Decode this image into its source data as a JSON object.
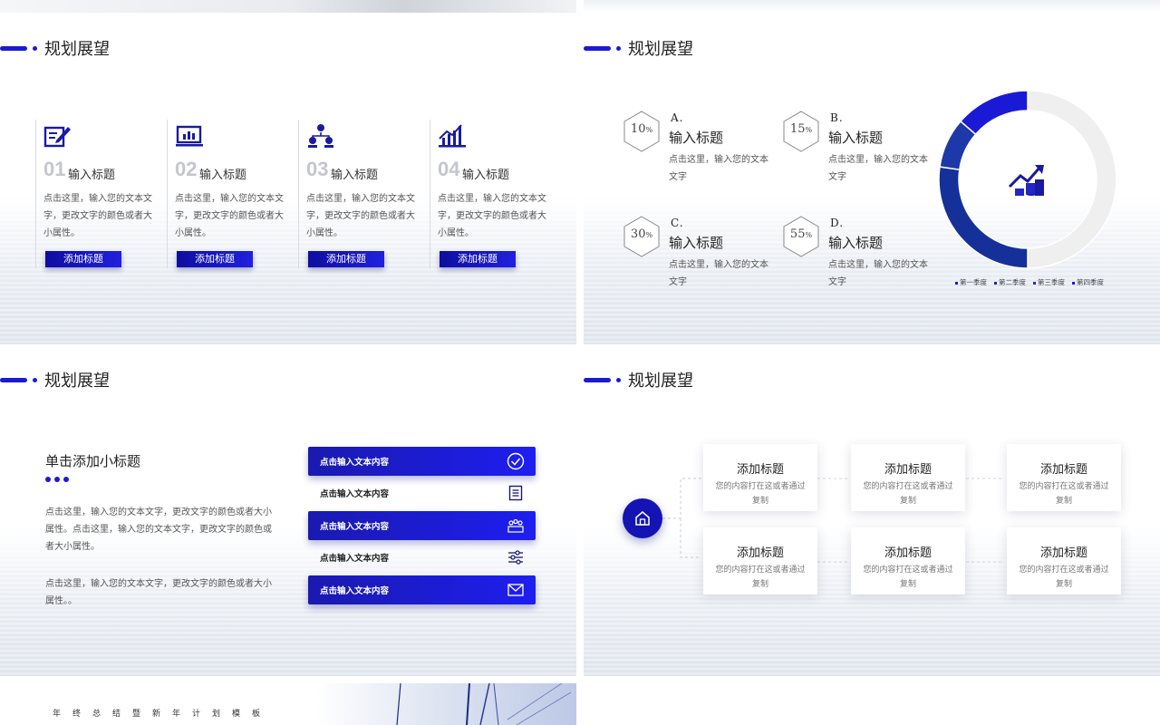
{
  "slide1": {
    "title": "规划展望",
    "columns": [
      {
        "num": "01",
        "title": "输入标题",
        "body": "点击这里，输入您的文本文字，更改文字的颜色或者大小属性。",
        "button": "添加标题",
        "icon": "edit-icon"
      },
      {
        "num": "02",
        "title": "输入标题",
        "body": "点击这里，输入您的文本文字，更改文字的颜色或者大小属性。",
        "button": "添加标题",
        "icon": "chart-icon"
      },
      {
        "num": "03",
        "title": "输入标题",
        "body": "点击这里，输入您的文本文字，更改文字的颜色或者大小属性。",
        "button": "添加标题",
        "icon": "team-icon"
      },
      {
        "num": "04",
        "title": "输入标题",
        "body": "点击这里，输入您的文本文字，更改文字的颜色或者大小属性。",
        "button": "添加标题",
        "icon": "bar-chart-icon"
      }
    ]
  },
  "slide2": {
    "title": "规划展望",
    "items": [
      {
        "pct": "10",
        "unit": "%",
        "letter": "A.",
        "title": "输入标题",
        "body": "点击这里，输入您的文本文字"
      },
      {
        "pct": "15",
        "unit": "%",
        "letter": "B.",
        "title": "输入标题",
        "body": "点击这里，输入您的文本文字"
      },
      {
        "pct": "30",
        "unit": "%",
        "letter": "C.",
        "title": "输入标题",
        "body": "点击这里，输入您的文本文字"
      },
      {
        "pct": "55",
        "unit": "%",
        "letter": "D.",
        "title": "输入标题",
        "body": "点击这里，输入您的文本文字"
      }
    ]
  },
  "chart_data": {
    "type": "pie",
    "categories": [
      "第一季度",
      "第二季度",
      "第三季度",
      "第四季度"
    ],
    "values": [
      55,
      30,
      10,
      15
    ],
    "colors": [
      "#efefef",
      "#16309a",
      "#1d38a8",
      "#1a1ad6"
    ],
    "legend_colors": [
      "#1a1ad6",
      "#16309a",
      "#1d38a8",
      "#1a1ad6"
    ],
    "legend": "bottom"
  },
  "slide3": {
    "title": "规划展望",
    "subtitle": "单击添加小标题",
    "para1": "点击这里，输入您的文本文字，更改文字的颜色或者大小属性。点击这里，输入您的文本文字，更改文字的颜色或者大小属性。",
    "para2": "点击这里，输入您的文本文字，更改文字的颜色或者大小属性。。",
    "rows": [
      {
        "text": "点击输入文本内容",
        "icon": "check-circle-icon"
      },
      {
        "text": "点击输入文本内容",
        "icon": "document-icon"
      },
      {
        "text": "点击输入文本内容",
        "icon": "crowd-icon"
      },
      {
        "text": "点击输入文本内容",
        "icon": "sliders-icon"
      },
      {
        "text": "点击输入文本内容",
        "icon": "mail-icon"
      }
    ]
  },
  "slide4": {
    "title": "规划展望",
    "cards": [
      {
        "title": "添加标题",
        "body": "您的内容打在这或者通过复制"
      },
      {
        "title": "添加标题",
        "body": "您的内容打在这或者通过复制"
      },
      {
        "title": "添加标题",
        "body": "您的内容打在这或者通过复制"
      },
      {
        "title": "添加标题",
        "body": "您的内容打在这或者通过复制"
      },
      {
        "title": "添加标题",
        "body": "您的内容打在这或者通过复制"
      },
      {
        "title": "添加标题",
        "body": "您的内容打在这或者通过复制"
      }
    ]
  },
  "footer": {
    "text": "年终总结暨新年计划模板"
  },
  "colors": {
    "accent": "#1a1ad6",
    "navy": "#16309a",
    "gray": "#efefef"
  }
}
